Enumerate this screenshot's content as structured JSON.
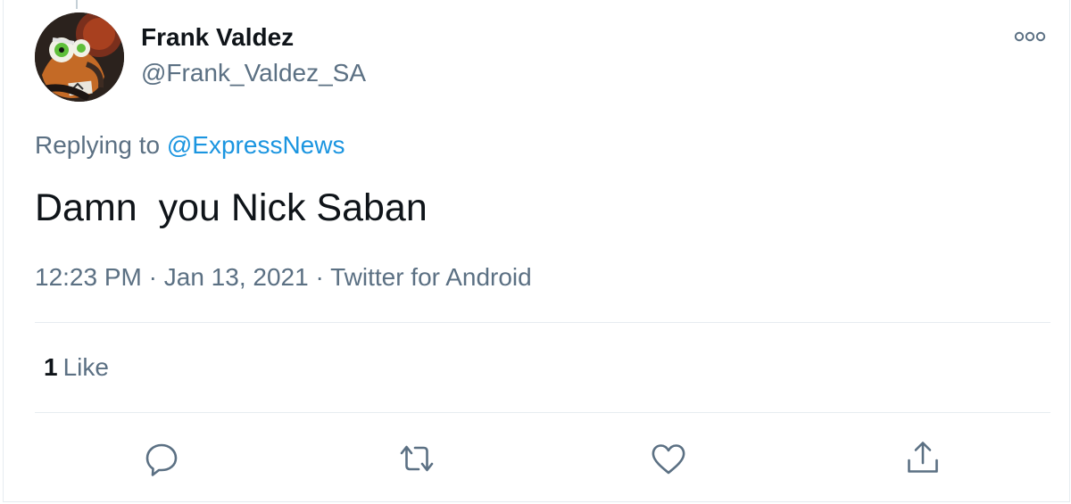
{
  "tweet": {
    "author": {
      "name": "Frank Valdez",
      "handle": "@Frank_Valdez_SA"
    },
    "replying_to_prefix": "Replying to",
    "replying_to": "@ExpressNews",
    "text": "Damn  you Nick Saban",
    "time": "12:23 PM",
    "separator": "·",
    "date": "Jan 13, 2021",
    "source": "Twitter for Android",
    "stats": {
      "likes_count": "1",
      "likes_label": "Like"
    }
  },
  "icons": {
    "more": "more-horizontal-icon",
    "reply": "reply-icon",
    "retweet": "retweet-icon",
    "like": "heart-icon",
    "share": "share-icon"
  },
  "colors": {
    "link": "#1b95e0",
    "secondary_text": "#5b7083",
    "primary_text": "#0f1419",
    "divider": "#e6ecf0"
  }
}
